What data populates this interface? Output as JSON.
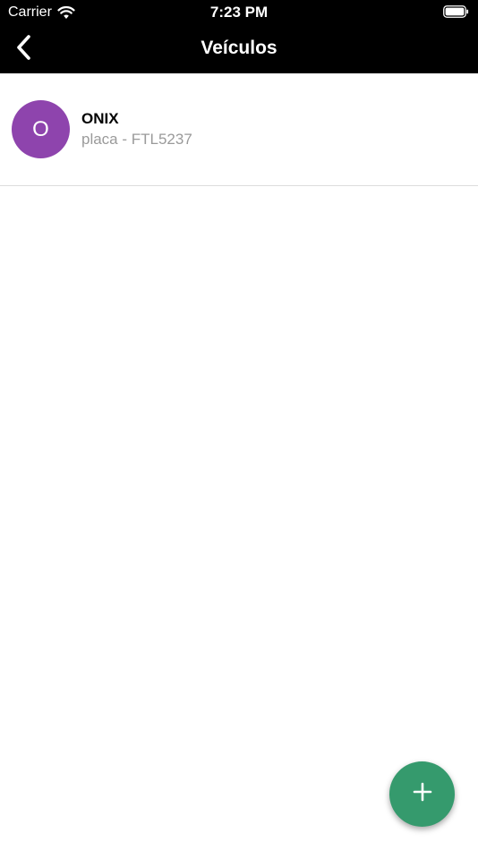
{
  "status_bar": {
    "carrier": "Carrier",
    "time": "7:23 PM",
    "wifi_icon": "wifi-icon",
    "battery_icon": "battery-icon"
  },
  "nav": {
    "title": "Veículos",
    "back_icon": "chevron-left-icon"
  },
  "vehicles": [
    {
      "avatar_letter": "O",
      "avatar_color": "#8e44ad",
      "name": "ONIX",
      "plate": "placa - FTL5237"
    }
  ],
  "fab": {
    "icon": "plus-icon",
    "color": "#359a6d"
  }
}
